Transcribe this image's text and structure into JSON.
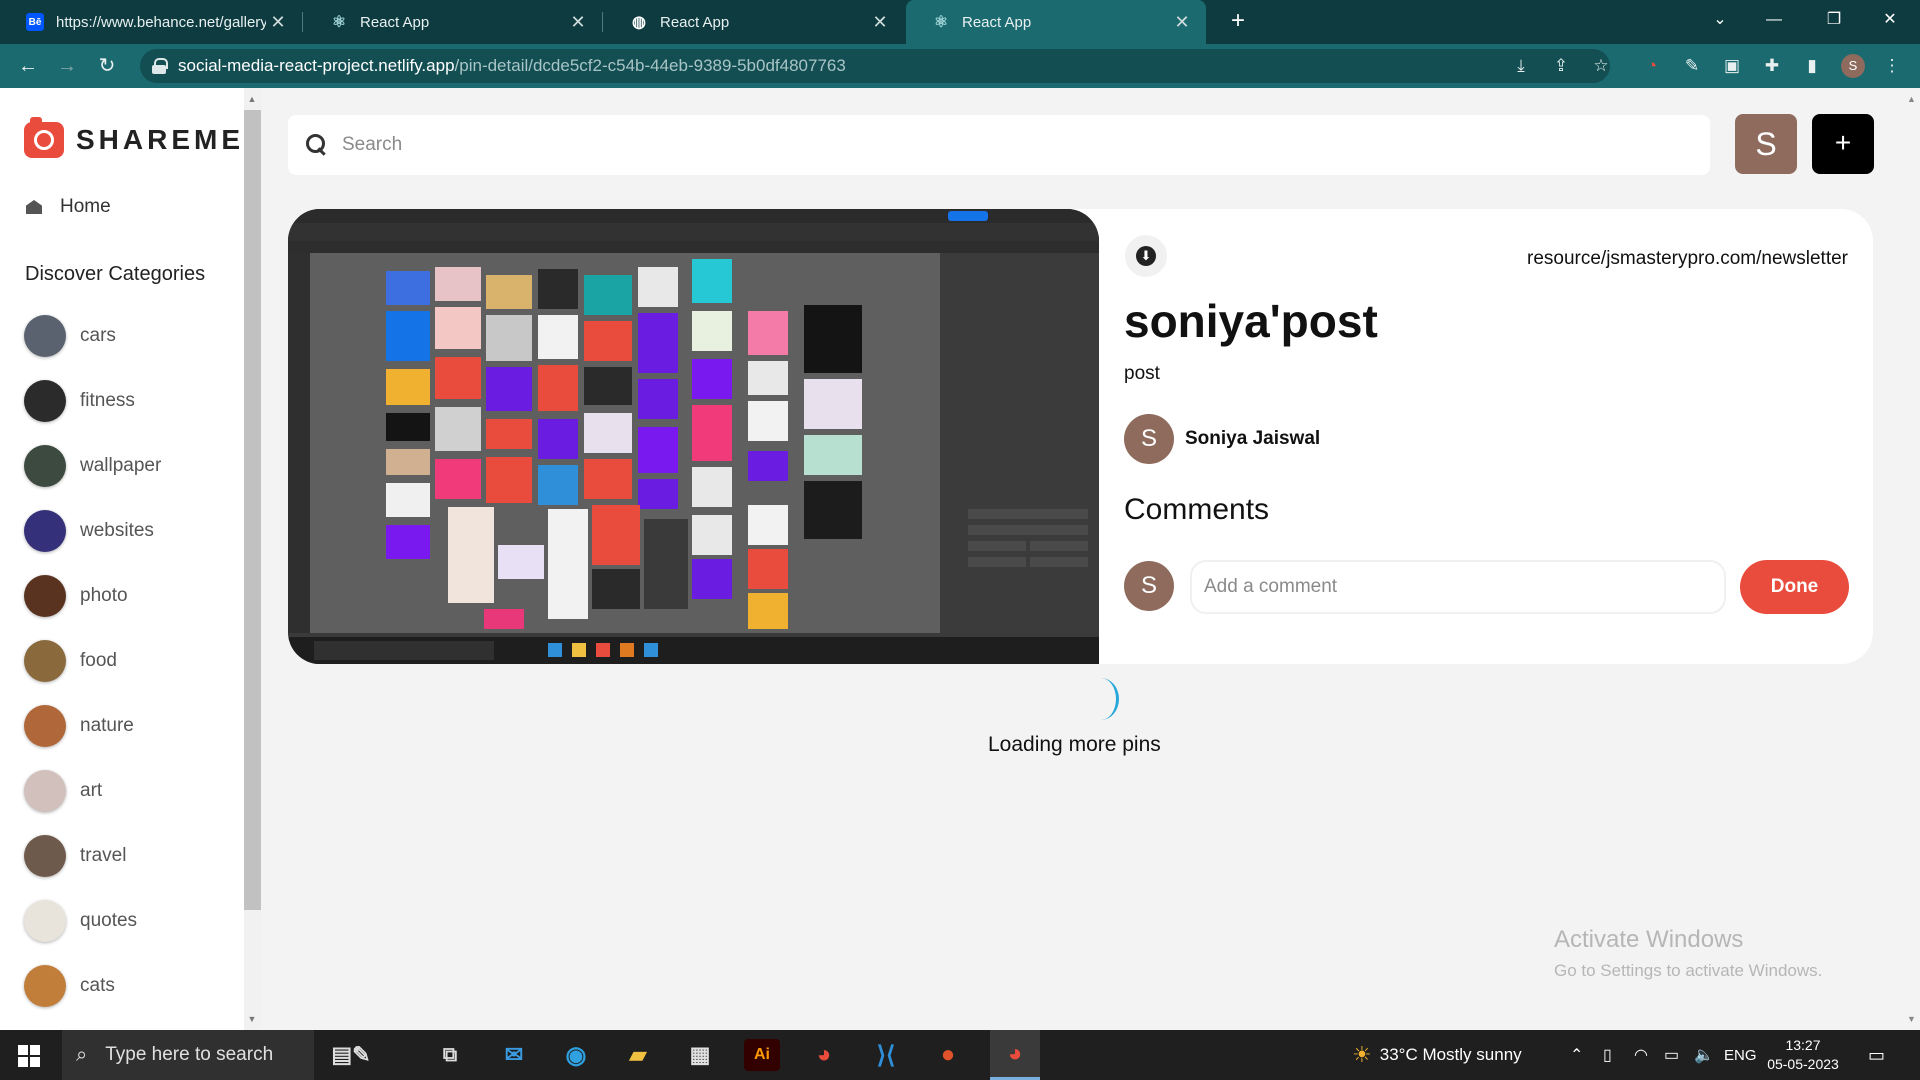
{
  "browser": {
    "tabs": [
      {
        "favicon": "Bē",
        "title": "https://www.behance.net/gallery",
        "active": false
      },
      {
        "favicon": "react-icon",
        "title": "React App",
        "active": false
      },
      {
        "favicon": "globe-icon",
        "title": "React App",
        "active": false
      },
      {
        "favicon": "react-icon",
        "title": "React App",
        "active": true
      }
    ],
    "url_host": "social-media-react-project.netlify.app",
    "url_path": "/pin-detail/dcde5cf2-c54b-44eb-9389-5b0df4807763",
    "profile_initial": "S"
  },
  "sidebar": {
    "logo": "SHAREME",
    "home_label": "Home",
    "discover_title": "Discover Categories",
    "categories": [
      {
        "label": "cars",
        "color": "#5a6270"
      },
      {
        "label": "fitness",
        "color": "#2b2b2b"
      },
      {
        "label": "wallpaper",
        "color": "#3d4a40"
      },
      {
        "label": "websites",
        "color": "#34307a"
      },
      {
        "label": "photo",
        "color": "#5a3320"
      },
      {
        "label": "food",
        "color": "#8a6a3c"
      },
      {
        "label": "nature",
        "color": "#b0683a"
      },
      {
        "label": "art",
        "color": "#d1c0bb"
      },
      {
        "label": "travel",
        "color": "#6e5a4c"
      },
      {
        "label": "quotes",
        "color": "#e8e4dc"
      },
      {
        "label": "cats",
        "color": "#c07e3a"
      }
    ]
  },
  "header": {
    "search_placeholder": "Search",
    "user_initial": "S",
    "create_label": "+"
  },
  "pin": {
    "destination": "resource/jsmasterypro.com/newsletter",
    "title": "soniya'post",
    "about": "post",
    "author_initial": "S",
    "author_name": "Soniya Jaiswal",
    "comments_heading": "Comments",
    "commenter_initial": "S",
    "comment_placeholder": "Add a comment",
    "done_label": "Done"
  },
  "loading_text": "Loading more pins",
  "watermark": {
    "line1": "Activate Windows",
    "line2": "Go to Settings to activate Windows."
  },
  "taskbar": {
    "search_placeholder": "Type here to search",
    "weather": "33°C  Mostly sunny",
    "language": "ENG",
    "time": "13:27",
    "date": "05-05-2023"
  },
  "colors": {
    "tabbar": "#0d3b3f",
    "toolbar": "#1a6a6f",
    "accent_red": "#e94b3c",
    "avatar_brown": "#8e6b5d"
  }
}
